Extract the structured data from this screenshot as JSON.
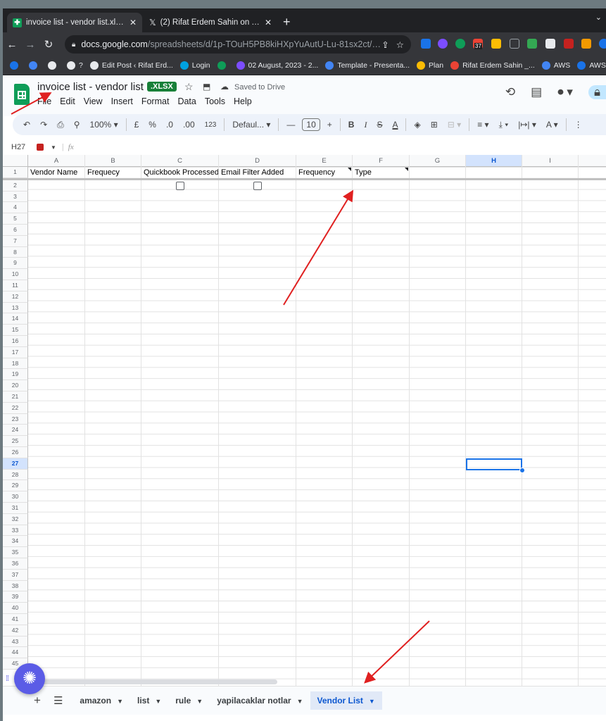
{
  "browser": {
    "tabs": [
      {
        "title": "invoice list - vendor list.xlsx - Goo",
        "active": true
      },
      {
        "title": "(2) Rifat Erdem Sahin on Twitter:",
        "active": false
      }
    ],
    "url_host": "docs.google.com",
    "url_path": "/spreadsheets/d/1p-TOuH5PB8kiHXpYuAutU-Lu-81sx2ct/edit#gi...",
    "extension_badge": "37",
    "bookmarks": [
      {
        "label": "",
        "color": "#1a73e8"
      },
      {
        "label": "",
        "color": "#4285f4"
      },
      {
        "label": "",
        "color": "#e8eaed"
      },
      {
        "label": "?",
        "color": "#e8eaed"
      },
      {
        "label": "Edit Post ‹ Rifat Erd...",
        "color": "#e8eaed"
      },
      {
        "label": "Login",
        "color": "#00a1e0"
      },
      {
        "label": "",
        "color": "#0f9d58"
      },
      {
        "label": "02 August, 2023 - 2...",
        "color": "#7c4dff"
      },
      {
        "label": "Template - Presenta...",
        "color": "#4285f4"
      },
      {
        "label": "Plan",
        "color": "#fbbc04"
      },
      {
        "label": "Rifat Erdem Sahin _...",
        "color": "#ea4335"
      },
      {
        "label": "AWS",
        "color": "#4285f4"
      },
      {
        "label": "AWS",
        "color": "#1a73e8"
      }
    ]
  },
  "doc": {
    "title": "invoice list - vendor list",
    "badge": ".XLSX",
    "saved_status": "Saved to Drive",
    "menu": [
      "File",
      "Edit",
      "View",
      "Insert",
      "Format",
      "Data",
      "Tools",
      "Help"
    ]
  },
  "toolbar": {
    "zoom": "100%",
    "currency": "£",
    "percent": "%",
    "dec_decrease": ".0",
    "dec_increase": ".00",
    "format_123": "123",
    "font": "Defaul...",
    "font_size": "10",
    "bold": "B",
    "italic": "I",
    "strike": "S",
    "text_color": "A"
  },
  "formula_bar": {
    "cell_ref": "H27",
    "fx": "fx",
    "value": ""
  },
  "sheet": {
    "columns": [
      "A",
      "B",
      "C",
      "D",
      "E",
      "F",
      "G",
      "H",
      "I"
    ],
    "selected_column": "H",
    "selected_row": 27,
    "row_count": 45,
    "headers": [
      "Vendor Name",
      "Frequecy",
      "Quickbook Processed",
      "Email Filter Added",
      "Frequency",
      "Type"
    ],
    "checkbox_columns": [
      "C",
      "D"
    ]
  },
  "sheet_tabs": [
    {
      "label": "amazon",
      "active": false
    },
    {
      "label": "list",
      "active": false
    },
    {
      "label": "rule",
      "active": false
    },
    {
      "label": "yapilacaklar notlar",
      "active": false
    },
    {
      "label": "Vendor List",
      "active": true
    }
  ],
  "colors": {
    "accent": "#1a73e8",
    "sheets_green": "#0f9d58",
    "annotation_red": "#e02020"
  }
}
